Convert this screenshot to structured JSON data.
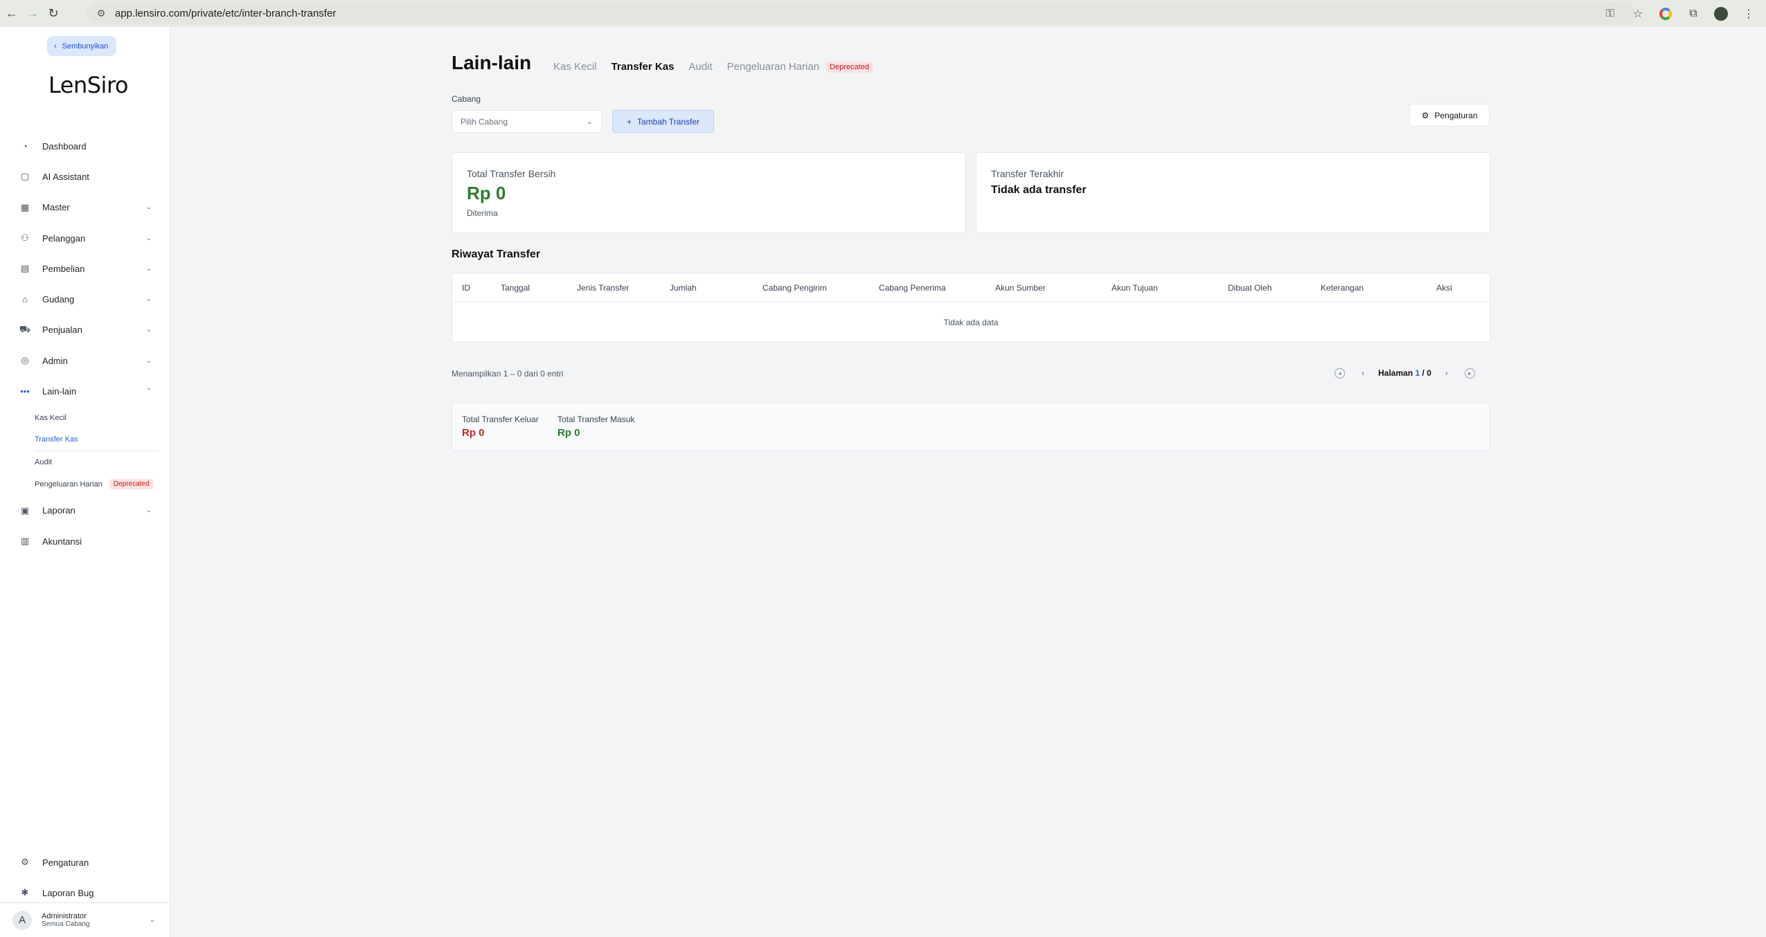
{
  "browser": {
    "url": "app.lensiro.com/private/etc/inter-branch-transfer"
  },
  "sidebar": {
    "hide_label": "Sembunyikan",
    "logo": "LenSiro",
    "items": [
      {
        "label": "Dashboard",
        "icon": "dashboard-icon"
      },
      {
        "label": "AI Assistant",
        "icon": "chat-icon"
      },
      {
        "label": "Master",
        "icon": "grid-icon"
      },
      {
        "label": "Pelanggan",
        "icon": "users-icon"
      },
      {
        "label": "Pembelian",
        "icon": "receipt-icon"
      },
      {
        "label": "Gudang",
        "icon": "warehouse-icon"
      },
      {
        "label": "Penjualan",
        "icon": "cart-icon"
      },
      {
        "label": "Admin",
        "icon": "admin-icon"
      },
      {
        "label": "Lain-lain",
        "icon": "more-icon"
      }
    ],
    "sub_items": [
      {
        "label": "Kas Kecil"
      },
      {
        "label": "Transfer Kas"
      },
      {
        "label": "Audit"
      },
      {
        "label": "Pengeluaran Harian",
        "badge": "Deprecated"
      }
    ],
    "items_after": [
      {
        "label": "Laporan",
        "icon": "clipboard-icon"
      },
      {
        "label": "Akuntansi",
        "icon": "book-icon"
      }
    ],
    "bottom_items": [
      {
        "label": "Pengaturan",
        "icon": "gear-icon"
      },
      {
        "label": "Laporan Bug",
        "icon": "bug-icon"
      }
    ],
    "user": {
      "initial": "A",
      "name": "Administrator",
      "branch": "Semua Cabang"
    }
  },
  "main": {
    "title": "Lain-lain",
    "tabs": [
      {
        "label": "Kas Kecil"
      },
      {
        "label": "Transfer Kas"
      },
      {
        "label": "Audit"
      },
      {
        "label": "Pengeluaran Harian"
      }
    ],
    "tab_badge": "Deprecated",
    "branch_label": "Cabang",
    "branch_placeholder": "Pilih Cabang",
    "add_button": "Tambah Transfer",
    "settings_button": "Pengaturan",
    "card_net": {
      "title": "Total Transfer Bersih",
      "amount": "Rp 0",
      "sub": "Diterima"
    },
    "card_last": {
      "title": "Transfer Terakhir",
      "value": "Tidak ada transfer"
    },
    "history_title": "Riwayat Transfer",
    "table": {
      "headers": [
        "ID",
        "Tanggal",
        "Jenis Transfer",
        "Jumlah",
        "Cabang Pengirim",
        "Cabang Penerima",
        "Akun Sumber",
        "Akun Tujuan",
        "Dibuat Oleh",
        "Keterangan",
        "Aksi"
      ],
      "empty": "Tidak ada data"
    },
    "pagination": {
      "info": "Menampilkan 1 – 0 dari 0 entri",
      "label": "Halaman",
      "current": "1",
      "separator": "/",
      "total": "0"
    },
    "totals": {
      "out_label": "Total Transfer Keluar",
      "out_value": "Rp 0",
      "in_label": "Total Transfer Masuk",
      "in_value": "Rp 0"
    }
  },
  "colors": {
    "accent": "#2563eb",
    "positive": "#2e7d32",
    "negative": "#c62828",
    "deprecated_bg": "#fde2e2"
  }
}
